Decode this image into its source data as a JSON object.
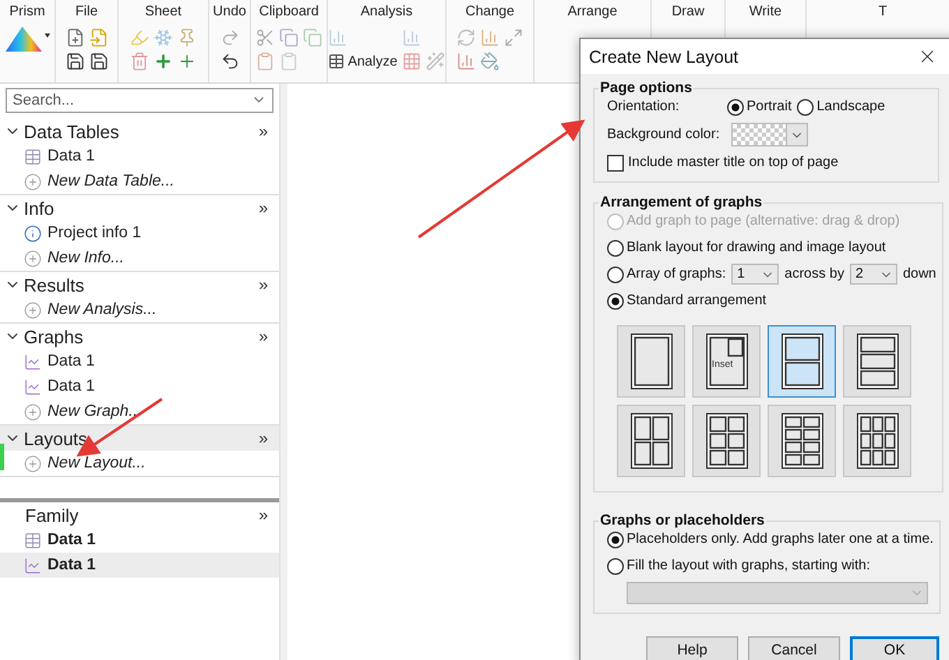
{
  "toolbar": {
    "groups": [
      {
        "label": "Prism"
      },
      {
        "label": "File"
      },
      {
        "label": "Sheet"
      },
      {
        "label": "Undo"
      },
      {
        "label": "Clipboard"
      },
      {
        "label": "Analysis",
        "button": "Analyze"
      },
      {
        "label": "Change"
      },
      {
        "label": "Arrange"
      },
      {
        "label": "Draw"
      },
      {
        "label": "Write"
      },
      {
        "label": "T"
      }
    ]
  },
  "navigator": {
    "search": {
      "placeholder": "Search..."
    },
    "sections": [
      {
        "title": "Data Tables",
        "more": "»",
        "expanded": true,
        "selected": false,
        "items": [
          {
            "kind": "table",
            "label": "Data 1"
          },
          {
            "kind": "new",
            "label": "New Data Table..."
          }
        ]
      },
      {
        "title": "Info",
        "more": "»",
        "expanded": true,
        "selected": false,
        "items": [
          {
            "kind": "info",
            "label": "Project info 1"
          },
          {
            "kind": "new",
            "label": "New Info..."
          }
        ]
      },
      {
        "title": "Results",
        "more": "»",
        "expanded": true,
        "selected": false,
        "items": [
          {
            "kind": "new",
            "label": "New Analysis..."
          }
        ]
      },
      {
        "title": "Graphs",
        "more": "»",
        "expanded": true,
        "selected": false,
        "items": [
          {
            "kind": "graph",
            "label": "Data 1"
          },
          {
            "kind": "graph",
            "label": "Data 1"
          },
          {
            "kind": "new",
            "label": "New Graph..."
          }
        ]
      },
      {
        "title": "Layouts",
        "more": "»",
        "expanded": true,
        "selected": true,
        "items": [
          {
            "kind": "new",
            "label": "New Layout..."
          }
        ]
      }
    ],
    "family": {
      "title": "Family",
      "more": "»",
      "items": [
        {
          "kind": "table",
          "label": "Data 1",
          "selected": false
        },
        {
          "kind": "graph",
          "label": "Data 1",
          "selected": true
        }
      ]
    }
  },
  "dialog": {
    "title": "Create New Layout",
    "page_options": {
      "title": "Page options",
      "orientation_label": "Orientation:",
      "orientations": [
        {
          "label": "Portrait",
          "selected": true
        },
        {
          "label": "Landscape",
          "selected": false
        }
      ],
      "background_label": "Background color:",
      "master_title": {
        "label": "Include master title on top of page",
        "checked": false
      }
    },
    "arrangement": {
      "title": "Arrangement of graphs",
      "options": [
        {
          "kind": "plain",
          "label": "Add graph to page (alternative: drag & drop)",
          "selected": false,
          "disabled": true
        },
        {
          "kind": "plain",
          "label": "Blank layout for drawing and image layout",
          "selected": false,
          "disabled": false
        },
        {
          "kind": "array",
          "label": "Array of graphs:",
          "across": "1",
          "across_label": "across by",
          "down": "2",
          "down_label": "down",
          "selected": false,
          "disabled": false
        },
        {
          "kind": "plain",
          "label": "Standard arrangement",
          "selected": true,
          "disabled": false
        }
      ],
      "layouts": [
        {
          "kind": "single",
          "selected": false
        },
        {
          "kind": "inset",
          "label": "Inset",
          "selected": false
        },
        {
          "kind": "rows2",
          "selected": true
        },
        {
          "kind": "rows3",
          "selected": false
        },
        {
          "kind": "grid2x2",
          "selected": false
        },
        {
          "kind": "grid3x2",
          "selected": false
        },
        {
          "kind": "grid4x2",
          "selected": false
        },
        {
          "kind": "grid3x3",
          "selected": false
        }
      ]
    },
    "placeholders": {
      "title": "Graphs or placeholders",
      "options": [
        {
          "label": "Placeholders only. Add graphs later one at a time.",
          "selected": true
        },
        {
          "label": "Fill the layout with graphs, starting with:",
          "selected": false
        }
      ],
      "starting_with": {
        "disabled": true
      }
    },
    "buttons": [
      {
        "label": "Help",
        "default": false
      },
      {
        "label": "Cancel",
        "default": false
      },
      {
        "label": "OK",
        "default": true
      }
    ]
  }
}
